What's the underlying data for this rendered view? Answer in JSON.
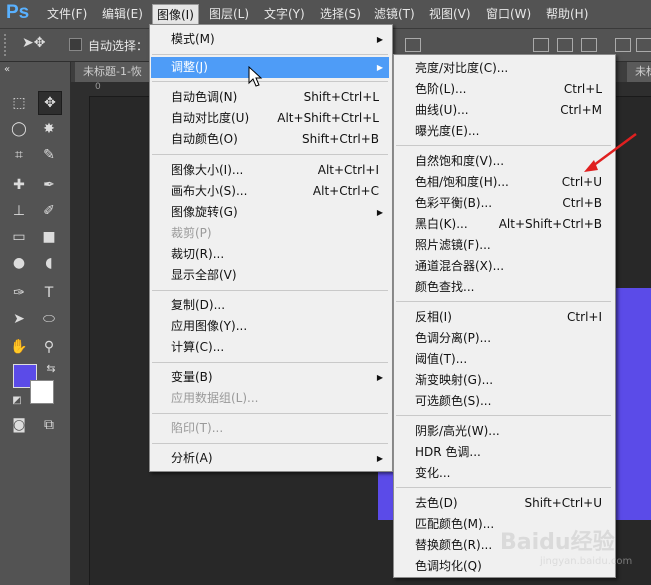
{
  "app": {
    "logo": "Ps"
  },
  "menubar": [
    {
      "label": "文件(F)"
    },
    {
      "label": "编辑(E)"
    },
    {
      "label": "图像(I)"
    },
    {
      "label": "图层(L)"
    },
    {
      "label": "文字(Y)"
    },
    {
      "label": "选择(S)"
    },
    {
      "label": "滤镜(T)"
    },
    {
      "label": "视图(V)"
    },
    {
      "label": "窗口(W)"
    },
    {
      "label": "帮助(H)"
    }
  ],
  "options_bar": {
    "auto_select_label": "自动选择："
  },
  "document_tabs": [
    {
      "label": "未标题-1-恢"
    },
    {
      "label": "未标"
    }
  ],
  "ruler": {
    "h_labels": [
      "0",
      "0"
    ]
  },
  "image_menu": {
    "items": [
      {
        "label": "模式(M)",
        "shortcut": "",
        "submenu": true
      },
      {
        "label": "调整(J)",
        "shortcut": "",
        "submenu": true,
        "highlighted": true
      },
      {
        "label": "自动色调(N)",
        "shortcut": "Shift+Ctrl+L"
      },
      {
        "label": "自动对比度(U)",
        "shortcut": "Alt+Shift+Ctrl+L"
      },
      {
        "label": "自动颜色(O)",
        "shortcut": "Shift+Ctrl+B"
      },
      {
        "label": "图像大小(I)...",
        "shortcut": "Alt+Ctrl+I"
      },
      {
        "label": "画布大小(S)...",
        "shortcut": "Alt+Ctrl+C"
      },
      {
        "label": "图像旋转(G)",
        "shortcut": "",
        "submenu": true
      },
      {
        "label": "裁剪(P)",
        "shortcut": "",
        "disabled": true
      },
      {
        "label": "裁切(R)...",
        "shortcut": ""
      },
      {
        "label": "显示全部(V)",
        "shortcut": ""
      },
      {
        "label": "复制(D)...",
        "shortcut": ""
      },
      {
        "label": "应用图像(Y)...",
        "shortcut": ""
      },
      {
        "label": "计算(C)...",
        "shortcut": ""
      },
      {
        "label": "变量(B)",
        "shortcut": "",
        "submenu": true
      },
      {
        "label": "应用数据组(L)...",
        "shortcut": "",
        "disabled": true
      },
      {
        "label": "陷印(T)...",
        "shortcut": "",
        "disabled": true
      },
      {
        "label": "分析(A)",
        "shortcut": "",
        "submenu": true
      }
    ]
  },
  "adjust_menu": {
    "items": [
      {
        "label": "亮度/对比度(C)...",
        "shortcut": ""
      },
      {
        "label": "色阶(L)...",
        "shortcut": "Ctrl+L"
      },
      {
        "label": "曲线(U)...",
        "shortcut": "Ctrl+M"
      },
      {
        "label": "曝光度(E)...",
        "shortcut": ""
      },
      {
        "label": "自然饱和度(V)...",
        "shortcut": ""
      },
      {
        "label": "色相/饱和度(H)...",
        "shortcut": "Ctrl+U"
      },
      {
        "label": "色彩平衡(B)...",
        "shortcut": "Ctrl+B"
      },
      {
        "label": "黑白(K)...",
        "shortcut": "Alt+Shift+Ctrl+B"
      },
      {
        "label": "照片滤镜(F)...",
        "shortcut": ""
      },
      {
        "label": "通道混合器(X)...",
        "shortcut": ""
      },
      {
        "label": "颜色查找...",
        "shortcut": ""
      },
      {
        "label": "反相(I)",
        "shortcut": "Ctrl+I"
      },
      {
        "label": "色调分离(P)...",
        "shortcut": ""
      },
      {
        "label": "阈值(T)...",
        "shortcut": ""
      },
      {
        "label": "渐变映射(G)...",
        "shortcut": ""
      },
      {
        "label": "可选颜色(S)...",
        "shortcut": ""
      },
      {
        "label": "阴影/高光(W)...",
        "shortcut": ""
      },
      {
        "label": "HDR 色调...",
        "shortcut": ""
      },
      {
        "label": "变化...",
        "shortcut": ""
      },
      {
        "label": "去色(D)",
        "shortcut": "Shift+Ctrl+U"
      },
      {
        "label": "匹配颜色(M)...",
        "shortcut": ""
      },
      {
        "label": "替换颜色(R)...",
        "shortcut": ""
      },
      {
        "label": "色调均化(Q)",
        "shortcut": ""
      }
    ]
  },
  "watermark": {
    "text": "Baidu经验",
    "sub": "jingyan.baidu.com"
  },
  "colors": {
    "foreground": "#5b4be8",
    "background": "#ffffff",
    "highlight": "#4e9cf7",
    "annotation_arrow": "#e02020"
  }
}
